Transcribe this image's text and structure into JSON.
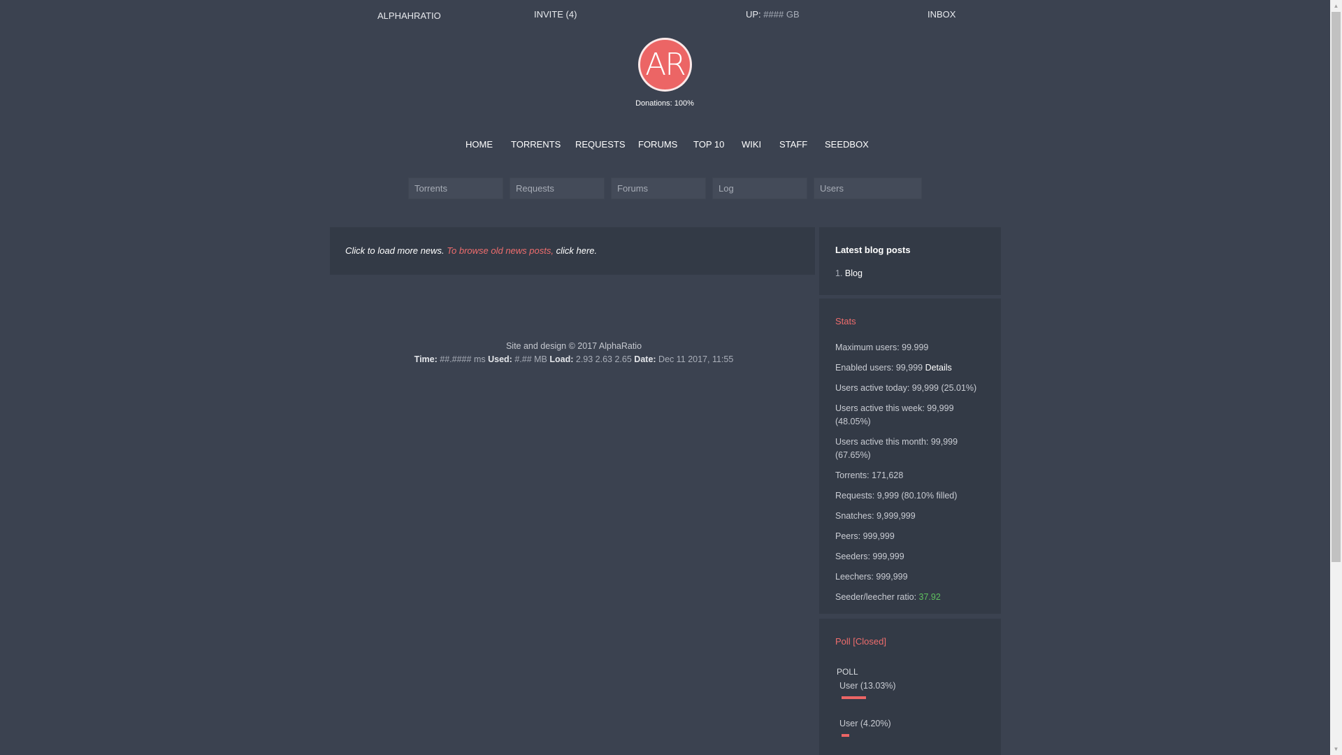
{
  "topbar": {
    "site": "ALPHAHRATIO",
    "invite": "INVITE (4)",
    "up_label": "UP:",
    "up_value": "#### GB",
    "inbox": "INBOX"
  },
  "logo": {
    "text": "AR"
  },
  "donations": "Donations: 100%",
  "main_nav": [
    "HOME",
    "TORRENTS",
    "REQUESTS",
    "FORUMS",
    "TOP 10",
    "WIKI",
    "STAFF",
    "SEEDBOX"
  ],
  "search": {
    "torrents": "Torrents",
    "requests": "Requests",
    "forums": "Forums",
    "log": "Log",
    "users": "Users"
  },
  "news": {
    "load_more": "Click to load more news.",
    "browse_old": "To browse old news posts,",
    "click_here": "click here."
  },
  "footer": {
    "line1": "Site and design © 2017 AlphaRatio",
    "time_label": "Time:",
    "time_value": "##.#### ms",
    "used_label": "Used:",
    "used_value": "#.## MB",
    "load_label": "Load:",
    "load_value": "2.93 2.63 2.65",
    "date_label": "Date:",
    "date_value": "Dec 11 2017, 11:55"
  },
  "blog": {
    "title": "Latest blog posts",
    "items": [
      {
        "num": "1.",
        "label": "Blog"
      }
    ]
  },
  "stats": {
    "title": "Stats",
    "max_users": "Maximum users: 99.999",
    "enabled_users": "Enabled users: 99,999",
    "details": "Details",
    "active_today": "Users active today: 99,999 (25.01%)",
    "active_week": "Users active this week: 99,999 (48.05%)",
    "active_month": "Users active this month: 99,999 (67.65%)",
    "torrents": "Torrents: 171,628",
    "requests": "Requests: 9,999 (80.10% filled)",
    "snatches": "Snatches: 9,999,999",
    "peers": "Peers: 999,999",
    "seeders": "Seeders: 999,999",
    "leechers": "Leechers: 999,999",
    "ratio_label": "Seeder/leecher ratio:",
    "ratio_value": "37.92",
    "ratio_color": "#5fc15f"
  },
  "poll": {
    "title": "Poll [Closed]",
    "question": "POLL",
    "answers": [
      {
        "label": "User (13.03%)",
        "percent": 13.03
      },
      {
        "label": "User (4.20%)",
        "percent": 4.2
      }
    ]
  },
  "colors": {
    "background": "#3b4250",
    "panel": "#333a46",
    "accent": "#ec6565"
  }
}
